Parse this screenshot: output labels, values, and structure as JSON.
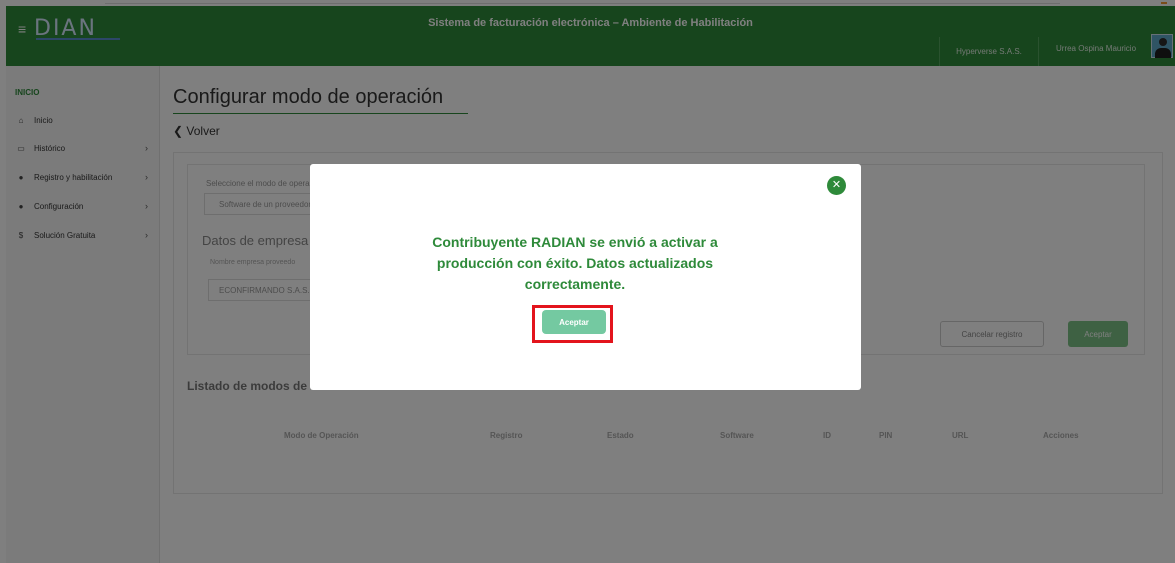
{
  "header": {
    "menu_icon": "hamburger-icon",
    "logo_text": "DIAN",
    "title": "Sistema de facturación electrónica – Ambiente de Habilitación",
    "company": "Hyperverse S.A.S.",
    "user": "Urrea Ospina Mauricio",
    "colors": {
      "header_bg": "#2e8a3a"
    }
  },
  "sidebar": {
    "section_label": "INICIO",
    "items": [
      {
        "label": "Inicio",
        "icon": "home-icon",
        "has_submenu": false
      },
      {
        "label": "Histórico",
        "icon": "monitor-icon",
        "has_submenu": true
      },
      {
        "label": "Registro y habilitación",
        "icon": "users-icon",
        "has_submenu": true
      },
      {
        "label": "Configuración",
        "icon": "users-icon",
        "has_submenu": true
      },
      {
        "label": "Solución Gratuita",
        "icon": "dollar-icon",
        "has_submenu": true
      }
    ]
  },
  "main": {
    "page_title": "Configurar modo de operación",
    "back_label": "Volver",
    "form": {
      "select_label": "Seleccione el modo de opera",
      "select_placeholder": "Software de un proveedor t",
      "company_heading": "Datos de empresa",
      "company_field_label": "Nombre empresa proveedo",
      "company_field_value": "ECONFIRMANDO S.A.S.",
      "cancel_label": "Cancelar registro",
      "save_label": "Aceptar"
    },
    "list_title": "Listado de modos de",
    "table_headers": [
      "Modo de Operación",
      "Registro",
      "Estado",
      "Software",
      "ID",
      "PIN",
      "URL",
      "Acciones"
    ]
  },
  "modal": {
    "message": "Contribuyente RADIAN se envió a activar a producción con éxito. Datos actualizados correctamente.",
    "accept_label": "Aceptar",
    "close_icon": "close-icon",
    "colors": {
      "message": "#2e8a3a",
      "accept_bg": "#74c9a1",
      "highlight_frame": "#e3141c"
    }
  }
}
